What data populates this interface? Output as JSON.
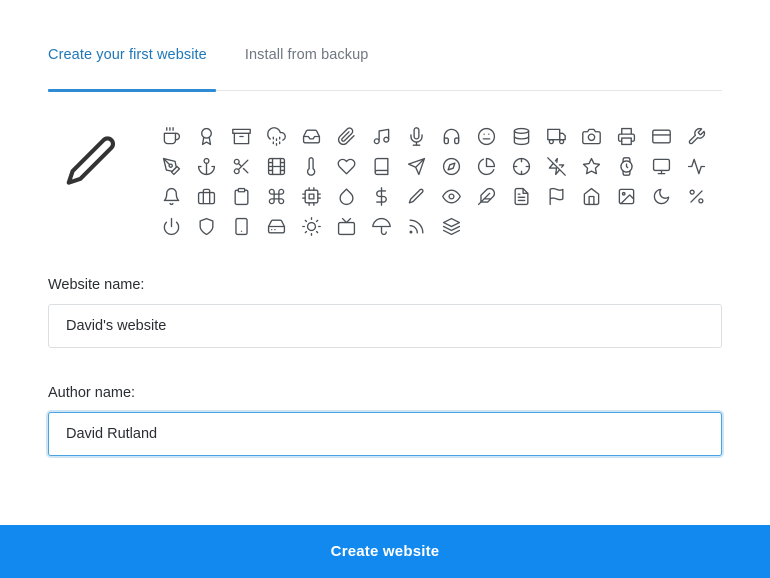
{
  "tabs": [
    {
      "label": "Create your first website",
      "active": true,
      "name": "tab-create-website"
    },
    {
      "label": "Install from backup",
      "active": false,
      "name": "tab-install-backup"
    }
  ],
  "colors": {
    "accent_blue": "#2e8bd4",
    "active_tab_text": "#2077b8",
    "inactive_tab_text": "#6f7780",
    "footer_button_bg": "#1189ef",
    "icon_stroke": "#4b5157",
    "input_border": "#dcdfe2",
    "input_border_focused": "#4aa3e0",
    "rule": "#e3e5e7"
  },
  "selected_icon": "pencil-icon",
  "icon_picker": {
    "preview_icon": "pencil-icon",
    "rows": [
      [
        "coffee-icon",
        "award-icon",
        "archive-icon",
        "cloud-drizzle-icon",
        "inbox-icon",
        "paperclip-icon",
        "music-icon",
        "mic-icon",
        "headphones-icon",
        "meh-icon",
        "database-icon",
        "truck-icon",
        "camera-icon",
        "printer-icon",
        "credit-card-icon",
        "tool-icon"
      ],
      [
        "pen-tool-icon",
        "anchor-icon",
        "scissors-icon",
        "film-icon",
        "thermometer-icon",
        "heart-icon",
        "book-icon",
        "send-icon",
        "compass-icon",
        "pie-chart-icon",
        "crosshair-icon",
        "zap-off-icon",
        "star-icon",
        "watch-icon",
        "monitor-icon",
        "activity-icon"
      ],
      [
        "bell-icon",
        "briefcase-icon",
        "clipboard-icon",
        "command-icon",
        "cpu-icon",
        "droplet-icon",
        "dollar-sign-icon",
        "pencil-icon",
        "eye-icon",
        "feather-icon",
        "file-text-icon",
        "flag-icon",
        "home-icon",
        "image-icon",
        "moon-icon",
        "percent-icon"
      ],
      [
        "power-icon",
        "shield-icon",
        "smartphone-icon",
        "hard-drive-icon",
        "sun-icon",
        "tv-icon",
        "umbrella-icon",
        "rss-icon",
        "layers-icon"
      ]
    ]
  },
  "form": {
    "website": {
      "label": "Website name:",
      "value": "David's website",
      "placeholder": "Website name",
      "focused": false
    },
    "author": {
      "label": "Author name:",
      "value": "David Rutland",
      "placeholder": "Author name",
      "focused": true
    }
  },
  "footer": {
    "create_label": "Create website"
  }
}
